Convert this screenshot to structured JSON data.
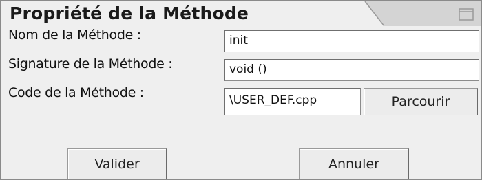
{
  "window": {
    "title": "Propriété de la Méthode",
    "maximize_icon": "maximize-icon"
  },
  "form": {
    "name_label": "Nom de la Méthode :",
    "name_value": "init",
    "signature_label": "Signature de la Méthode :",
    "signature_value": "void ()",
    "code_label": "Code de la Méthode :",
    "code_value": "\\USER_DEF.cpp"
  },
  "buttons": {
    "browse": "Parcourir",
    "validate": "Valider",
    "cancel": "Annuler"
  }
}
